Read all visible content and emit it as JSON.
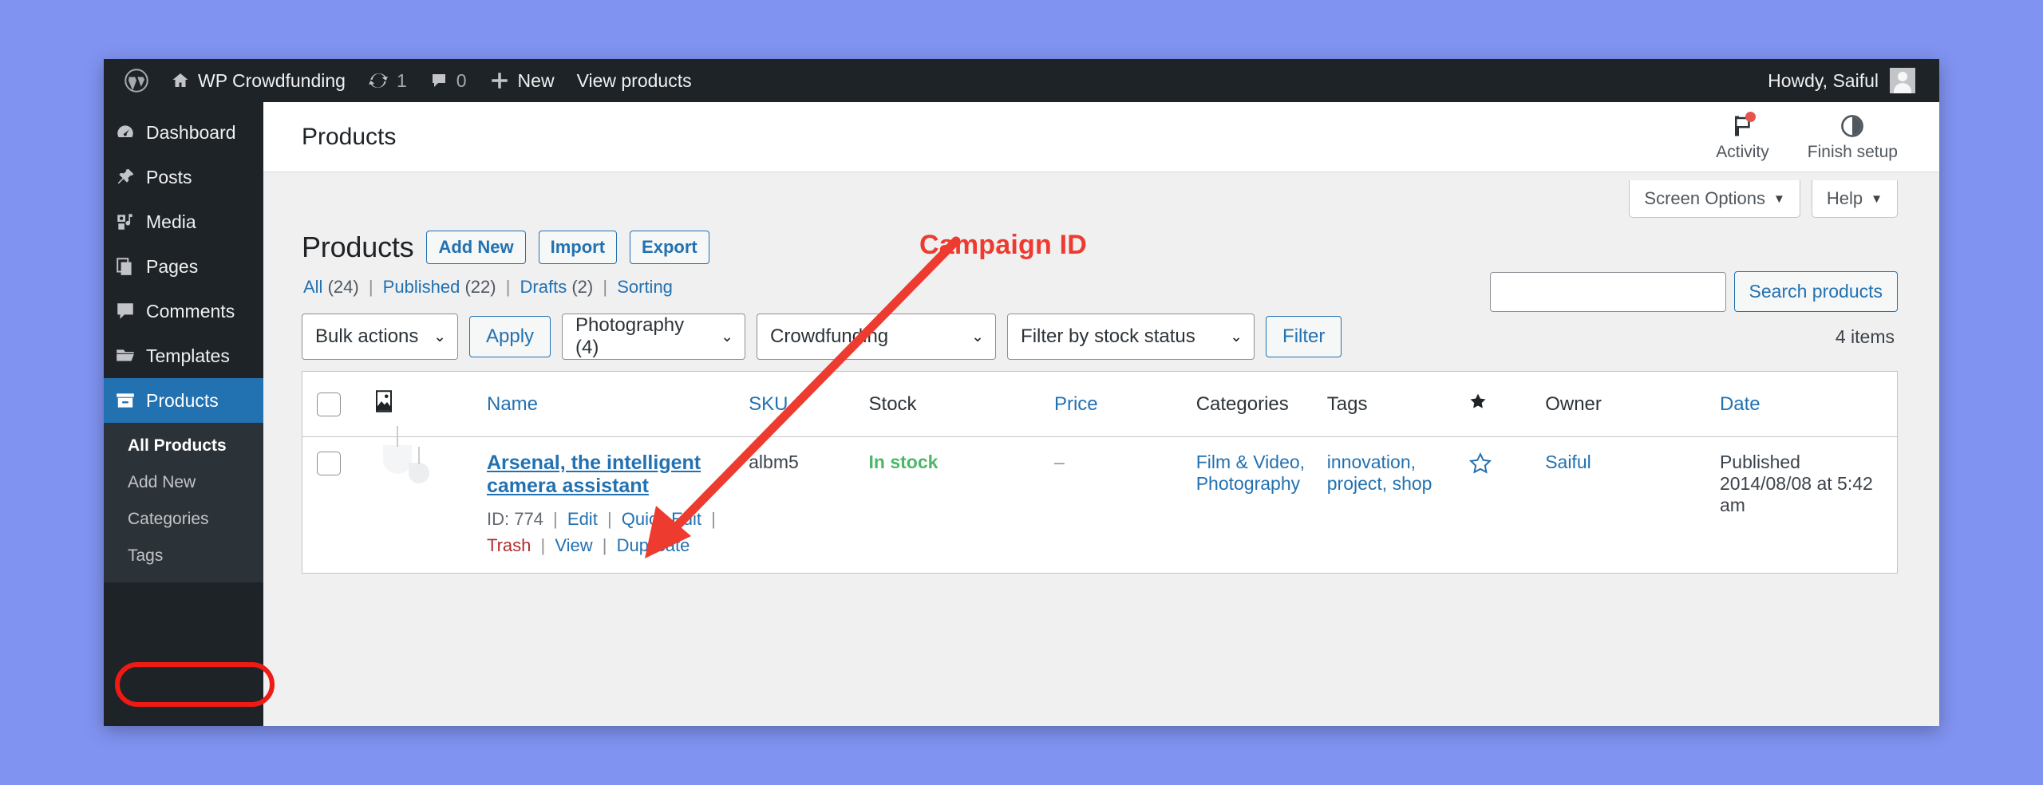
{
  "adminbar": {
    "logo_icon": "wordpress-logo-icon",
    "site_icon": "home-icon",
    "site_name": "WP Crowdfunding",
    "updates_icon": "updates-icon",
    "updates_count": "1",
    "comments_icon": "comment-bubble-icon",
    "comments_count": "0",
    "new_icon": "plus-icon",
    "new_label": "New",
    "view_products_label": "View products",
    "howdy": "Howdy, Saiful",
    "avatar_icon": "avatar-icon"
  },
  "sidebar": {
    "items": [
      {
        "label": "Dashboard",
        "icon": "dashboard-icon",
        "current": false
      },
      {
        "label": "Posts",
        "icon": "pin-icon",
        "current": false
      },
      {
        "label": "Media",
        "icon": "media-icon",
        "current": false
      },
      {
        "label": "Pages",
        "icon": "pages-icon",
        "current": false
      },
      {
        "label": "Comments",
        "icon": "comment-bubble-icon",
        "current": false
      },
      {
        "label": "Templates",
        "icon": "folder-icon",
        "current": false
      },
      {
        "label": "Products",
        "icon": "products-box-icon",
        "current": true
      }
    ],
    "submenu": [
      {
        "label": "All Products",
        "current": true
      },
      {
        "label": "Add New",
        "current": false
      },
      {
        "label": "Categories",
        "current": false
      },
      {
        "label": "Tags",
        "current": false
      }
    ]
  },
  "wc_header": {
    "title": "Products",
    "activity_label": "Activity",
    "activity_icon": "flag-icon",
    "finish_setup_label": "Finish setup",
    "finish_setup_icon": "pie-progress-icon"
  },
  "screen_meta": {
    "screen_options": "Screen Options",
    "help": "Help"
  },
  "page": {
    "title": "Products",
    "actions": [
      "Add New",
      "Import",
      "Export"
    ]
  },
  "status_links": [
    {
      "label": "All",
      "count": "(24)"
    },
    {
      "label": "Published",
      "count": "(22)"
    },
    {
      "label": "Drafts",
      "count": "(2)"
    },
    {
      "label": "Sorting",
      "count": ""
    }
  ],
  "search": {
    "value": "",
    "placeholder": "",
    "button_label": "Search products"
  },
  "tablenav": {
    "bulk_actions": "Bulk actions",
    "apply_label": "Apply",
    "category_filter": "Photography  (4)",
    "product_type_filter": "Crowdfunding",
    "stock_filter": "Filter by stock status",
    "filter_label": "Filter",
    "items_count": "4 items"
  },
  "table": {
    "columns": [
      {
        "label": "",
        "name": "select-all"
      },
      {
        "label": "",
        "name": "image"
      },
      {
        "label": "Name",
        "name": "name",
        "sortable": true
      },
      {
        "label": "SKU",
        "name": "sku",
        "sortable": true
      },
      {
        "label": "Stock",
        "name": "stock",
        "sortable": false
      },
      {
        "label": "Price",
        "name": "price",
        "sortable": true
      },
      {
        "label": "Categories",
        "name": "categories",
        "sortable": false
      },
      {
        "label": "Tags",
        "name": "tags",
        "sortable": false
      },
      {
        "label": "★",
        "name": "featured",
        "sortable": false
      },
      {
        "label": "Owner",
        "name": "owner",
        "sortable": false
      },
      {
        "label": "Date",
        "name": "date",
        "sortable": true
      }
    ],
    "rows": [
      {
        "name": "Arsenal, the intelligent camera assistant",
        "id_label": "ID: 774",
        "actions": [
          "Edit",
          "Quick Edit",
          "Trash",
          "View",
          "Duplicate"
        ],
        "sku": "albm5",
        "stock": "In stock",
        "price": "–",
        "categories": [
          "Film & Video",
          "Photography"
        ],
        "tags": [
          "innovation",
          "project",
          "shop"
        ],
        "featured": "star-outline-icon",
        "owner": "Saiful",
        "date": "Published 2014/08/08 at 5:42 am"
      }
    ]
  },
  "annotation": {
    "label": "Campaign ID",
    "color": "#ee3b2f"
  },
  "colors": {
    "accent_blue": "#2271b1",
    "admin_dark": "#1d2327",
    "submenu_dark": "#2c3338",
    "in_stock_green": "#4ab866",
    "trash_red": "#b32d2e",
    "annotation_red": "#ee3b2f",
    "page_bg": "#8093f1"
  }
}
